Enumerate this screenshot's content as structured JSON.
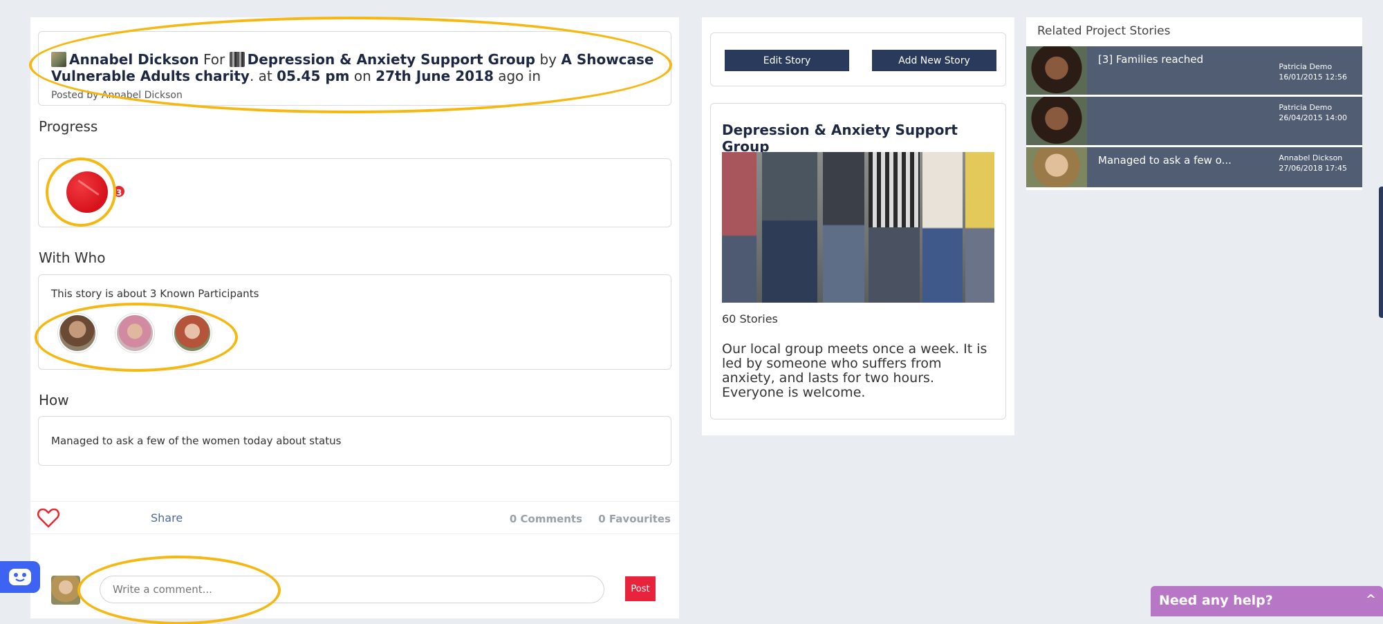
{
  "story": {
    "author": "Annabel Dickson",
    "for_label": "For",
    "group": "Depression & Anxiety Support Group",
    "by_label": "by",
    "charity": "A Showcase Vulnerable Adults charity",
    "at_label": ". at",
    "time": "05.45 pm",
    "on_label": "on",
    "date": "27th June 2018",
    "ago_label": "ago in",
    "posted_by": "Posted by Annabel Dickson"
  },
  "progress": {
    "title": "Progress",
    "badge_count": "3",
    "badge_color": "#e8262f"
  },
  "with_who": {
    "title": "With Who",
    "text": "This story is about 3 Known Participants"
  },
  "how": {
    "title": "How",
    "text": "Managed to ask a few of the women today about status"
  },
  "actions": {
    "share_label": "Share",
    "comments": "0 Comments",
    "favourites": "0 Favourites"
  },
  "comment": {
    "placeholder": "Write a comment...",
    "post_label": "Post"
  },
  "buttons": {
    "edit_story": "Edit Story",
    "add_story": "Add New Story"
  },
  "group_card": {
    "title": "Depression & Anxiety Support Group",
    "stories": "60 Stories",
    "description": "Our local group meets once a week. It is led by someone who suffers from anxiety, and lasts for two hours. Everyone is welcome."
  },
  "related": {
    "title": "Related Project Stories",
    "items": [
      {
        "title": "[3] Families reached",
        "author": "Patricia Demo",
        "datetime": "16/01/2015 12:56"
      },
      {
        "title": "",
        "author": "Patricia Demo",
        "datetime": "26/04/2015 14:00"
      },
      {
        "title": "Managed to ask a few o...",
        "author": "Annabel Dickson",
        "datetime": "27/06/2018 17:45"
      }
    ]
  },
  "help": {
    "label": "Need any help?",
    "chevron": "^"
  },
  "colors": {
    "accent_dark": "#2a3a5d",
    "highlight": "#f5b813",
    "post_red": "#e8233c",
    "help_purple": "#b877c6",
    "chat_blue": "#3d63f2"
  }
}
